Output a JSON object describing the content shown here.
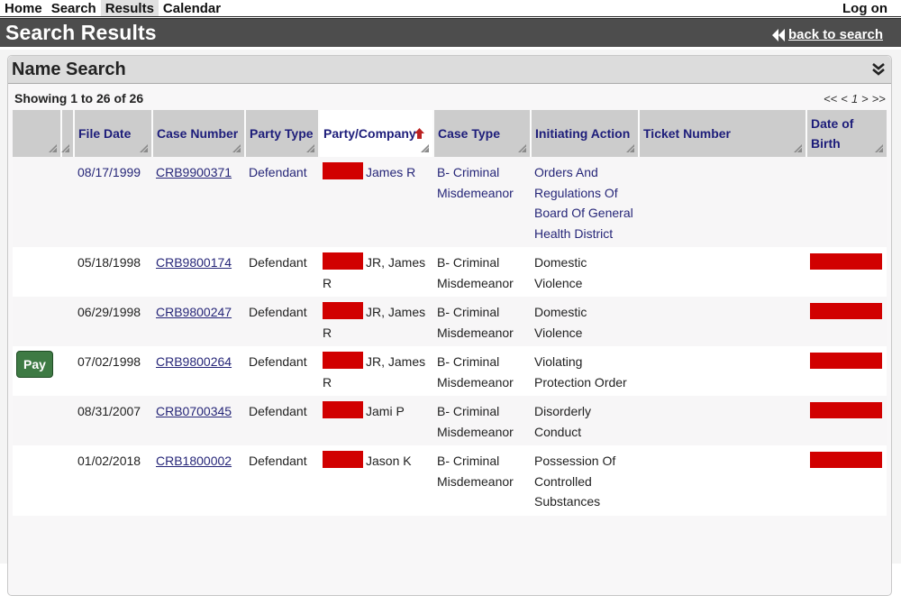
{
  "nav": {
    "items": [
      {
        "label": "Home",
        "active": false
      },
      {
        "label": "Search",
        "active": false
      },
      {
        "label": "Results",
        "active": true
      },
      {
        "label": "Calendar",
        "active": false
      }
    ],
    "logon": "Log on"
  },
  "header": {
    "title": "Search Results",
    "back_label": "back to search",
    "back_icon": "double-chevron-left-icon"
  },
  "panel": {
    "title": "Name Search",
    "collapse_icon": "double-chevron-down-icon",
    "showing": "Showing 1 to 26 of 26",
    "pager": {
      "first": "<<",
      "prev": "<",
      "current": "1",
      "next": ">",
      "last": ">>"
    }
  },
  "table": {
    "columns": [
      {
        "key": "action",
        "label": ""
      },
      {
        "key": "blank",
        "label": ""
      },
      {
        "key": "file_date",
        "label": "File Date"
      },
      {
        "key": "case_number",
        "label": "Case Number"
      },
      {
        "key": "party_type",
        "label": "Party Type"
      },
      {
        "key": "party_company",
        "label": "Party/Company",
        "sorted": "ascending"
      },
      {
        "key": "case_type",
        "label": "Case Type"
      },
      {
        "key": "initiating_action",
        "label": "Initiating Action"
      },
      {
        "key": "ticket_number",
        "label": "Ticket Number"
      },
      {
        "key": "dob",
        "label": "Date of Birth"
      }
    ],
    "redaction_color": "#d10000",
    "rows": [
      {
        "pay": "",
        "file_date": "08/17/1999",
        "case_number": "CRB9900371",
        "party_type": "Defendant",
        "party_name": "James R",
        "case_type": "B- Criminal Misdemeanor",
        "initiating_action": "Orders And Regulations Of Board Of General Health District",
        "ticket_number": "",
        "dob_redacted": false
      },
      {
        "pay": "",
        "file_date": "05/18/1998",
        "case_number": "CRB9800174",
        "party_type": "Defendant",
        "party_name": "JR, James R",
        "case_type": "B- Criminal Misdemeanor",
        "initiating_action": "Domestic Violence",
        "ticket_number": "",
        "dob_redacted": true
      },
      {
        "pay": "",
        "file_date": "06/29/1998",
        "case_number": "CRB9800247",
        "party_type": "Defendant",
        "party_name": "JR, James R",
        "case_type": "B- Criminal Misdemeanor",
        "initiating_action": "Domestic Violence",
        "ticket_number": "",
        "dob_redacted": true
      },
      {
        "pay": "Pay",
        "file_date": "07/02/1998",
        "case_number": "CRB9800264",
        "party_type": "Defendant",
        "party_name": "JR, James R",
        "case_type": "B- Criminal Misdemeanor",
        "initiating_action": "Violating Protection Order",
        "ticket_number": "",
        "dob_redacted": true
      },
      {
        "pay": "",
        "file_date": "08/31/2007",
        "case_number": "CRB0700345",
        "party_type": "Defendant",
        "party_name": "Jami P",
        "case_type": "B- Criminal Misdemeanor",
        "initiating_action": "Disorderly Conduct",
        "ticket_number": "",
        "dob_redacted": true
      },
      {
        "pay": "",
        "file_date": "01/02/2018",
        "case_number": "CRB1800002",
        "party_type": "Defendant",
        "party_name": "Jason K",
        "case_type": "B- Criminal Misdemeanor",
        "initiating_action": "Possession Of Controlled Substances",
        "ticket_number": "",
        "dob_redacted": true
      }
    ]
  }
}
